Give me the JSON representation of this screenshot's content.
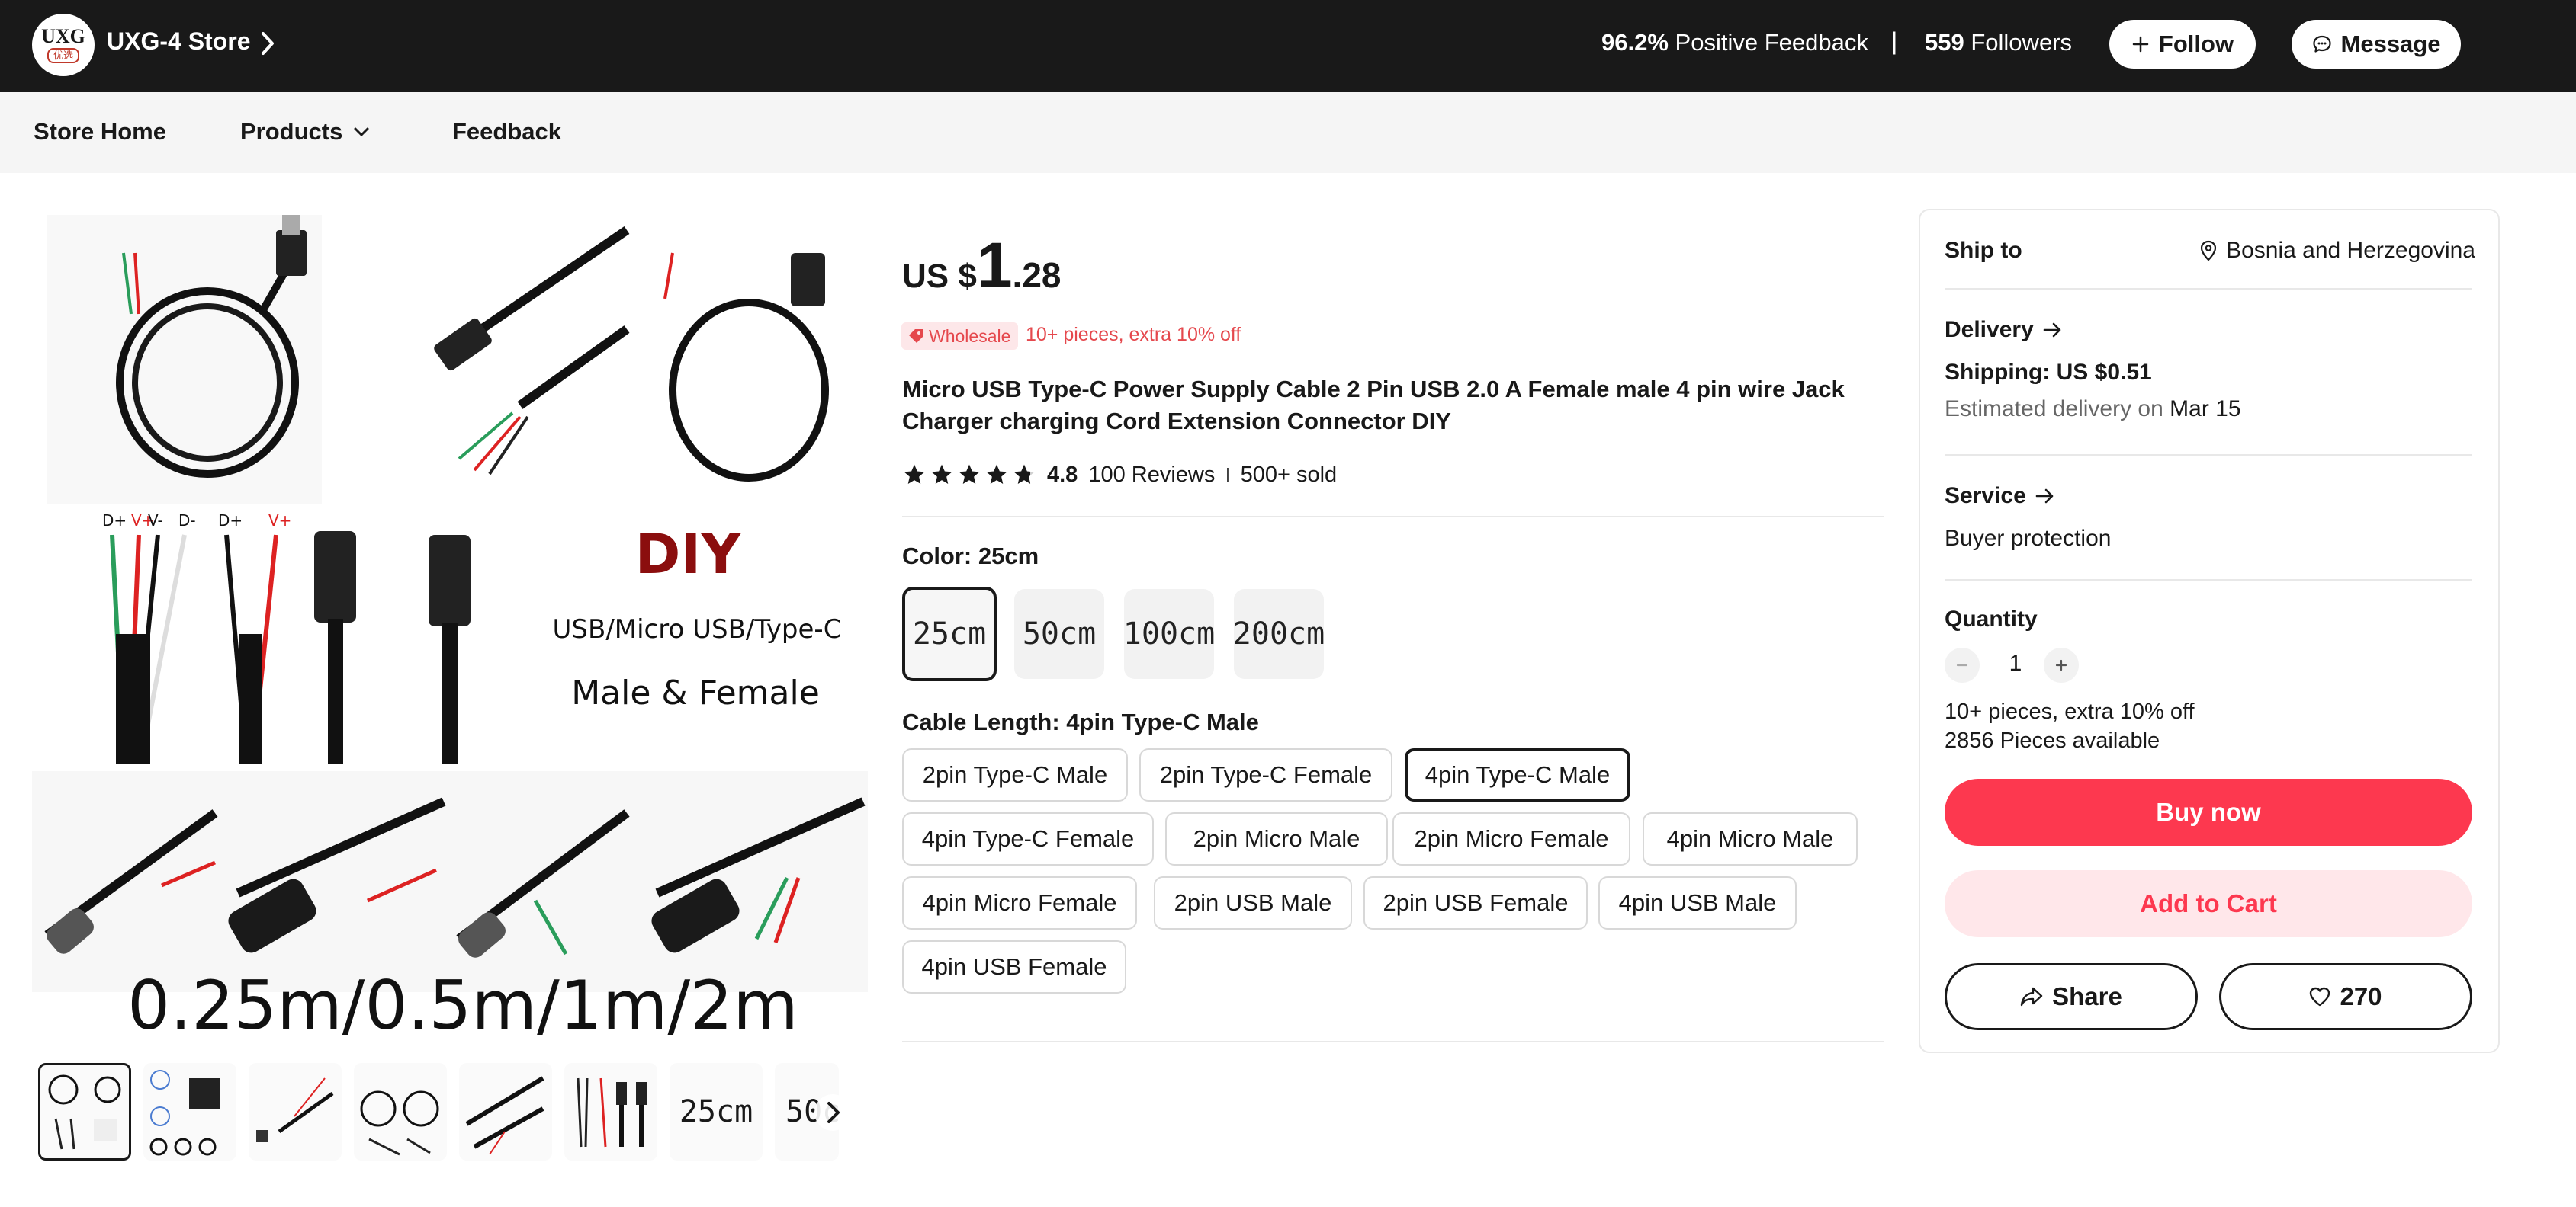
{
  "store": {
    "logo_text": "UXG",
    "logo_sub": "优选",
    "name": "UXG-4 Store",
    "feedback_value": "96.2%",
    "feedback_label": "Positive Feedback",
    "separator": "|",
    "followers_value": "559",
    "followers_label": "Followers",
    "follow_label": "Follow",
    "message_label": "Message"
  },
  "nav": {
    "items": [
      "Store Home",
      "Products",
      "Feedback"
    ]
  },
  "gallery": {
    "main_image_texts": {
      "diy": "DIY",
      "types": "USB/Micro USB/Type-C",
      "gender": "Male & Female",
      "lengths": "0.25m/0.5m/1m/2m",
      "pin_labels_4": [
        "D+",
        "V+",
        "V-",
        "D-"
      ],
      "pin_labels_2": [
        "V-",
        "V+"
      ]
    },
    "thumbnails": [
      "thumb-1",
      "thumb-2",
      "thumb-3",
      "thumb-4",
      "thumb-5",
      "thumb-6",
      "25cm",
      "50c"
    ]
  },
  "product": {
    "price_currency": "US $",
    "price_whole": "1",
    "price_fraction": ".28",
    "wholesale_tag": "Wholesale",
    "wholesale_text": "10+ pieces, extra 10% off",
    "title": "Micro USB Type-C Power Supply Cable 2 Pin USB 2.0 A Female male 4 pin wire Jack Charger charging Cord Extension Connector DIY",
    "rating": "4.8",
    "reviews": "100 Reviews",
    "sold": "500+ sold",
    "color_label": "Color: 25cm",
    "colors": [
      "25cm",
      "50cm",
      "100cm",
      "200cm"
    ],
    "selected_color": "25cm",
    "length_label": "Cable Length: 4pin Type-C Male",
    "lengths": [
      "2pin Type-C Male",
      "2pin Type-C Female",
      "4pin Type-C Male",
      "4pin Type-C Female",
      "2pin Micro Male",
      "2pin Micro Female",
      "4pin Micro Male",
      "4pin Micro Female",
      "2pin USB Male",
      "2pin USB Female",
      "4pin USB Male",
      "4pin USB Female"
    ],
    "selected_length": "4pin Type-C Male"
  },
  "sidebar": {
    "ship_to_label": "Ship to",
    "ship_to_value": "Bosnia and Herzegovina",
    "delivery_label": "Delivery",
    "shipping": "Shipping: US $0.51",
    "estimated_prefix": "Estimated delivery on",
    "estimated_date": "Mar 15",
    "service_label": "Service",
    "service_value": "Buyer protection",
    "quantity_label": "Quantity",
    "quantity_value": "1",
    "qty_note": "10+ pieces, extra 10% off",
    "available": "2856 Pieces available",
    "buy_now": "Buy now",
    "add_to_cart": "Add to Cart",
    "share": "Share",
    "wishlist_count": "270"
  },
  "colors": {
    "topbar": "#191919",
    "accent": "#fd384f",
    "accent_light": "#ffe7ea",
    "wholesale_red": "#e5484d",
    "border": "#e8e8e8"
  },
  "icons": [
    "chevron-right-icon",
    "plus-icon",
    "chat-bubble-icon",
    "chevron-down-icon",
    "tag-icon",
    "star-icon",
    "location-pin-icon",
    "arrow-right-icon",
    "minus-icon",
    "share-icon",
    "heart-icon"
  ]
}
